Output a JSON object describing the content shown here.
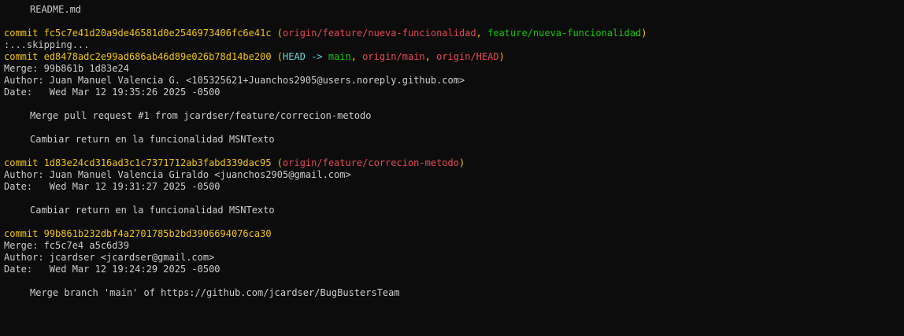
{
  "colors": {
    "background": "#0c0c0c",
    "text": "#cccccc",
    "commit_hash": "#f1c40f",
    "head": "#61d6d6",
    "remote_branch": "#e74856",
    "local_branch": "#16c60c"
  },
  "top_file": "README.md",
  "commit1": {
    "hash_line": "commit fc5c7e41d20a9de46581d0e2546973406fc6e41c",
    "open_paren": " (",
    "ref_remote": "origin/feature/nueva-funcionalidad",
    "sep": ", ",
    "ref_local": "feature/nueva-funcionalidad",
    "close_paren": ")"
  },
  "skipping": ":...skipping...",
  "commit2": {
    "hash_line": "commit ed8478adc2e99ad686ab46d89e026b78d14be200",
    "open_paren": " (",
    "head": "HEAD -> ",
    "ref_local": "main",
    "sep1": ", ",
    "ref_remote1": "origin/main",
    "sep2": ", ",
    "ref_remote2": "origin/HEAD",
    "close_paren": ")",
    "merge": "Merge: 99b861b 1d83e24",
    "author": "Author: Juan Manuel Valencia G. <105325621+Juanchos2905@users.noreply.github.com>",
    "date": "Date:   Wed Mar 12 19:35:26 2025 -0500",
    "message1": "Merge pull request #1 from jcardser/feature/correcion-metodo",
    "message2": "Cambiar return en la funcionalidad MSNTexto"
  },
  "commit3": {
    "hash_line": "commit 1d83e24cd316ad3c1c7371712ab3fabd339dac95",
    "open_paren": " (",
    "ref_remote": "origin/feature/correcion-metodo",
    "close_paren": ")",
    "author": "Author: Juan Manuel Valencia Giraldo <juanchos2905@gmail.com>",
    "date": "Date:   Wed Mar 12 19:31:27 2025 -0500",
    "message": "Cambiar return en la funcionalidad MSNTexto"
  },
  "commit4": {
    "hash_line": "commit 99b861b232dbf4a2701785b2bd3906694076ca30",
    "merge": "Merge: fc5c7e4 a5c6d39",
    "author": "Author: jcardser <jcardser@gmail.com>",
    "date": "Date:   Wed Mar 12 19:24:29 2025 -0500",
    "message": "Merge branch 'main' of https://github.com/jcardser/BugBustersTeam"
  }
}
